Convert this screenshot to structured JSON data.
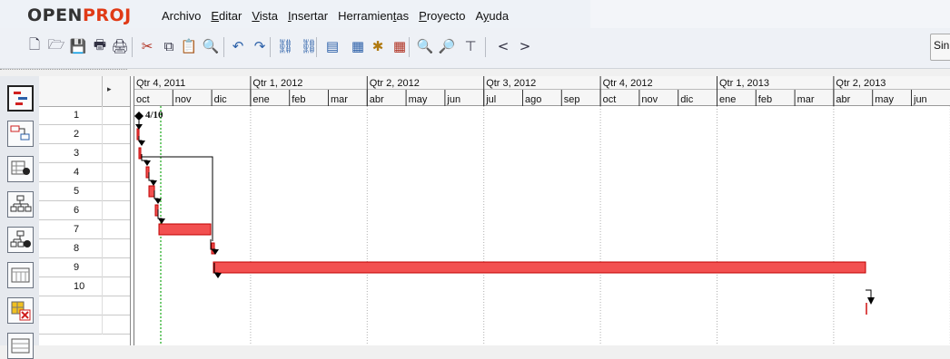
{
  "app": {
    "logo_part1": "OPEN",
    "logo_part2": "PROJ"
  },
  "menu": [
    "Archivo",
    "Editar",
    "Vista",
    "Insertar",
    "Herramientas",
    "Proyecto",
    "Ayuda"
  ],
  "menu_underline": [
    "",
    "E",
    "V",
    "I",
    "t",
    "P",
    "y"
  ],
  "toolbar": {
    "icons": [
      "new-task-icon",
      "open-icon",
      "save-icon",
      "print-icon",
      "print-preview-icon",
      "cut-icon",
      "copy-icon",
      "paste-icon",
      "find-icon",
      "undo-icon",
      "redo-icon",
      "link-icon",
      "unlink-icon",
      "task-info-icon",
      "notes-icon",
      "resource-icon",
      "calendar-icon",
      "zoom-in-icon",
      "zoom-out-icon",
      "filter-icon",
      "scroll-left-icon",
      "scroll-right-icon"
    ],
    "glyphs": [
      "🗋",
      "🗁",
      "💾",
      "🖶",
      "🖨",
      "✂",
      "⧉",
      "📋",
      "🔍",
      "↶",
      "↷",
      "⛓",
      "⛓",
      "▤",
      "▦",
      "✱",
      "▦",
      "🔍",
      "🔎",
      "⊤",
      "<",
      ">"
    ],
    "right_label": "Sin"
  },
  "rows": [
    "1",
    "2",
    "3",
    "4",
    "5",
    "6",
    "7",
    "8",
    "9",
    "10"
  ],
  "timeline": {
    "quarters": [
      "Qtr 4, 2011",
      "Qtr 1, 2012",
      "Qtr 2, 2012",
      "Qtr 3, 2012",
      "Qtr 4, 2012",
      "Qtr 1, 2013",
      "Qtr 2, 2013"
    ],
    "months": [
      "oct",
      "nov",
      "dic",
      "ene",
      "feb",
      "mar",
      "abr",
      "may",
      "jun",
      "jul",
      "ago",
      "sep",
      "oct",
      "nov",
      "dic",
      "ene",
      "feb",
      "mar",
      "abr",
      "may",
      "jun"
    ]
  },
  "milestone_label": "4/10",
  "colors": {
    "bar_fill": "#f25050",
    "bar_stroke": "#c00000",
    "today_line": "#18a818",
    "logo_red": "#e03a16"
  },
  "views": [
    "gantt-view-icon",
    "network-view-icon",
    "resource-view-icon",
    "wbs-view-icon",
    "rbs-view-icon",
    "report-view-icon",
    "delete-view-icon",
    "task-usage-view-icon"
  ]
}
